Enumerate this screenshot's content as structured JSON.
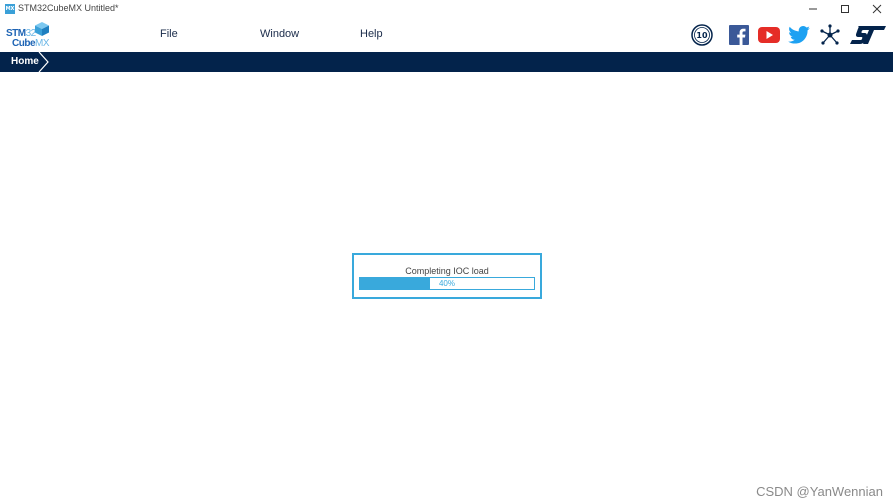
{
  "window": {
    "app_icon_text": "MX",
    "title": "STM32CubeMX Untitled*",
    "controls": [
      "minimize-icon",
      "maximize-icon",
      "close-icon"
    ]
  },
  "logo": {
    "line1_a": "STM",
    "line1_b": "32",
    "line2_a": "Cube",
    "line2_b": "MX"
  },
  "menu": {
    "items": [
      {
        "label": "File"
      },
      {
        "label": "Window"
      },
      {
        "label": "Help"
      }
    ]
  },
  "social": {
    "icons": [
      "anniversary-badge-icon",
      "facebook-icon",
      "youtube-icon",
      "twitter-icon",
      "network-icon",
      "st-logo-icon"
    ],
    "badge_text": "10",
    "colors": {
      "facebook": "#3b5998",
      "youtube": "#e52d27",
      "twitter": "#1da1f2",
      "st": "#03234b"
    }
  },
  "breadcrumb": {
    "home_label": "Home",
    "bar_color": "#03234b"
  },
  "dialog": {
    "message": "Completing IOC load",
    "progress_percent": 40,
    "progress_label": "40%",
    "accent_color": "#39a9dc"
  },
  "watermark": "CSDN @YanWennian"
}
